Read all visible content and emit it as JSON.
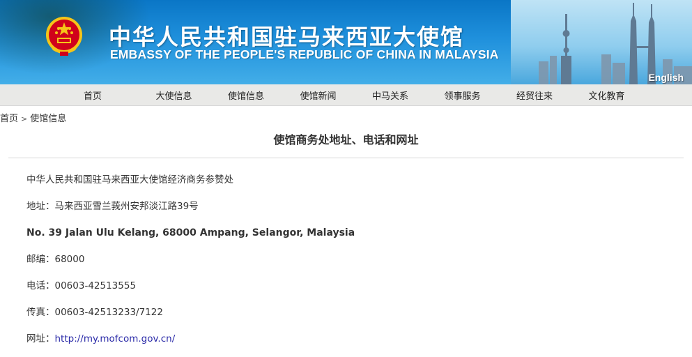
{
  "banner": {
    "title_cn": "中华人民共和国驻马来西亚大使馆",
    "title_en": "EMBASSY OF THE PEOPLE'S REPUBLIC OF CHINA IN MALAYSIA",
    "language_link": "English",
    "emblem_icon": "national-emblem-icon",
    "colors": {
      "banner_blue": "#1f90dc",
      "emblem_red": "#d0021b",
      "emblem_gold": "#f5c518"
    }
  },
  "nav": {
    "items": [
      {
        "label": "首页"
      },
      {
        "label": "大使信息"
      },
      {
        "label": "使馆信息"
      },
      {
        "label": "使馆新闻"
      },
      {
        "label": "中马关系"
      },
      {
        "label": "领事服务"
      },
      {
        "label": "经贸往来"
      },
      {
        "label": "文化教育"
      }
    ]
  },
  "breadcrumb": {
    "home": "首页",
    "separator": ">",
    "current": "使馆信息"
  },
  "article": {
    "title": "使馆商务处地址、电话和网址",
    "lines": {
      "org": "中华人民共和国驻马来西亚大使馆经济商务参赞处",
      "address_cn": "地址：马来西亚雪兰莪州安邦淡江路39号",
      "address_en": "No. 39 Jalan Ulu Kelang, 68000 Ampang, Selangor, Malaysia",
      "postcode": "邮编：68000",
      "phone": "电话：00603-42513555",
      "fax": "传真：00603-42513233/7122",
      "website_label": "网址：",
      "website_url": "http://my.mofcom.gov.cn/"
    },
    "colors": {
      "link": "#2a2aa8"
    }
  }
}
